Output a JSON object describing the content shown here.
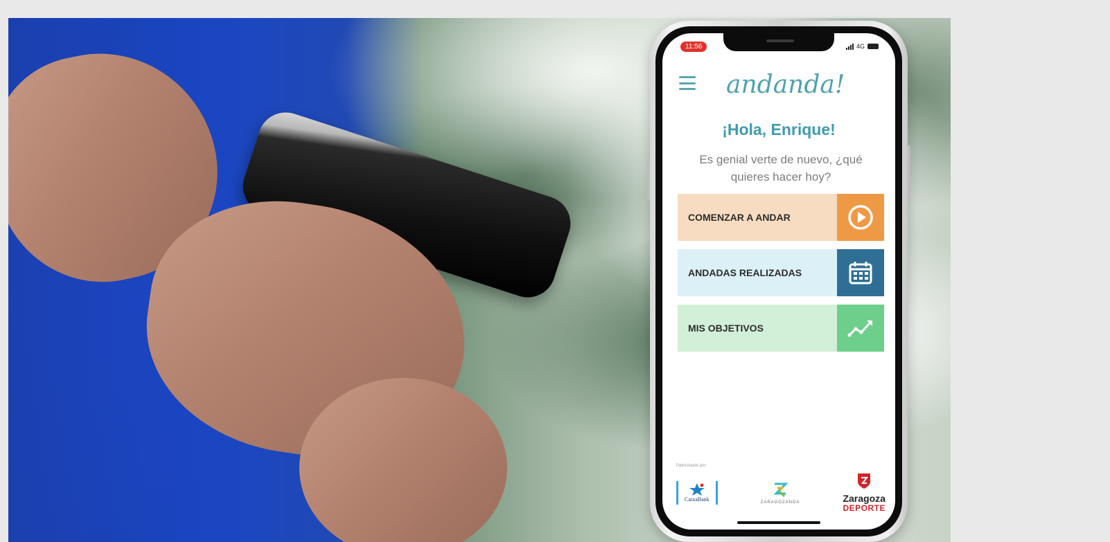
{
  "phone": {
    "status_time": "11:56",
    "network": "4G",
    "app_name": "andanda!",
    "greeting": "¡Hola, Enrique!",
    "subtitle": "Es genial verte de nuevo, ¿qué quieres hacer hoy?",
    "menu_items": [
      {
        "label": "COMENZAR A ANDAR",
        "icon": "play-icon",
        "color": "#ee9a45"
      },
      {
        "label": "ANDADAS REALIZADAS",
        "icon": "calendar-icon",
        "color": "#2f6f95"
      },
      {
        "label": "MIS OBJETIVOS",
        "icon": "trend-chart-icon",
        "color": "#6ecf8c"
      }
    ],
    "sponsors": {
      "label": "Patrocinado por:",
      "items": [
        {
          "name": "CaixaBank"
        },
        {
          "name": "ZARAGOZANDA"
        },
        {
          "name_line1": "Zaragoza",
          "name_line2": "DEPORTE"
        }
      ]
    }
  },
  "colors": {
    "brand_teal": "#4fa2ad",
    "background": "#e9e9ea"
  }
}
